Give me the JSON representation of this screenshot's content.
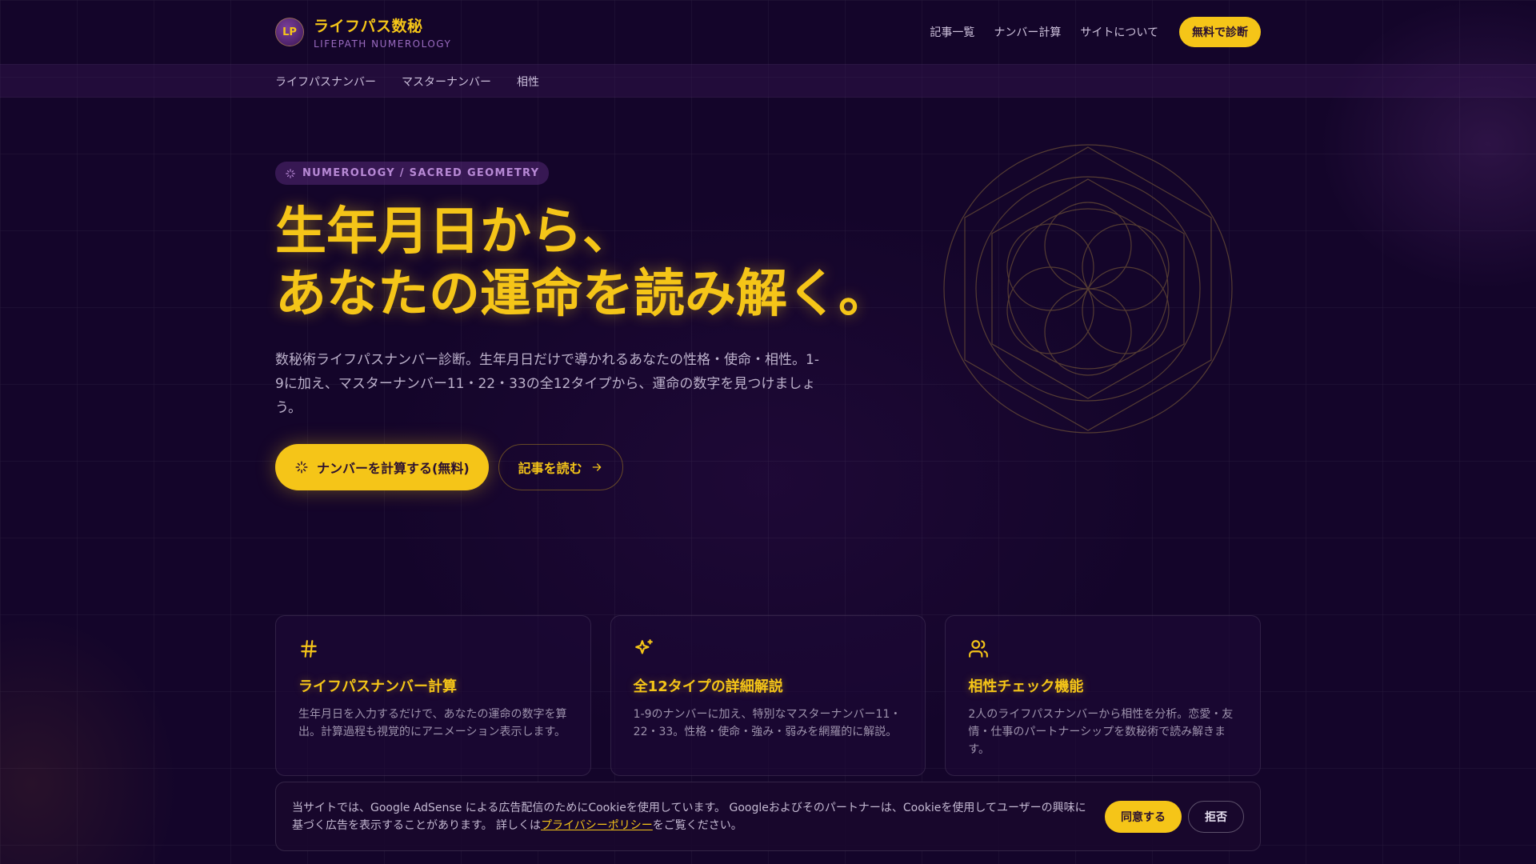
{
  "header": {
    "logo": "LP",
    "title": "ライフパス数秘",
    "subtitle": "LIFEPATH NUMEROLOGY",
    "nav": [
      "記事一覧",
      "ナンバー計算",
      "サイトについて"
    ],
    "cta": "無料で診断"
  },
  "subnav": [
    "ライフパスナンバー",
    "マスターナンバー",
    "相性"
  ],
  "hero": {
    "tag": "NUMEROLOGY / SACRED GEOMETRY",
    "title_line1": "生年月日から、",
    "title_line2": "あなたの運命を読み解く。",
    "description": "数秘術ライフパスナンバー診断。生年月日だけで導かれるあなたの性格・使命・相性。1-9に加え、マスターナンバー11・22・33の全12タイプから、運命の数字を見つけましょう。",
    "primary_button": "ナンバーを計算する(無料)",
    "secondary_button": "記事を読む"
  },
  "cards": [
    {
      "icon": "hash-icon",
      "title": "ライフパスナンバー計算",
      "description": "生年月日を入力するだけで、あなたの運命の数字を算出。計算過程も視覚的にアニメーション表示します。"
    },
    {
      "icon": "sparkles-icon",
      "title": "全12タイプの詳細解説",
      "description": "1-9のナンバーに加え、特別なマスターナンバー11・22・33。性格・使命・強み・弱みを網羅的に解説。"
    },
    {
      "icon": "users-icon",
      "title": "相性チェック機能",
      "description": "2人のライフパスナンバーから相性を分析。恋愛・友情・仕事のパートナーシップを数秘術で読み解きます。"
    }
  ],
  "cookie": {
    "text_before": "当サイトでは、Google AdSense による広告配信のためにCookieを使用しています。 Googleおよびそのパートナーは、Cookieを使用してユーザーの興味に基づく広告を表示することがあります。 詳しくは",
    "link": "プライバシーポリシー",
    "text_after": "をご覧ください。",
    "accept": "同意する",
    "reject": "拒否"
  },
  "colors": {
    "background": "#14052a",
    "accent": "#f5c518",
    "tag": "#b88ad6"
  }
}
